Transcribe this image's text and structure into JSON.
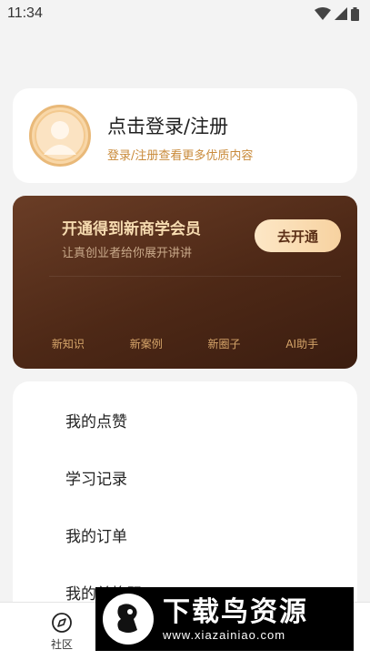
{
  "status_bar": {
    "time": "11:34",
    "icons": [
      "wifi-icon",
      "signal-icon",
      "battery-icon"
    ]
  },
  "login": {
    "title": "点击登录/注册",
    "subtitle": "登录/注册查看更多优质内容",
    "avatar_icon": "default-avatar-icon"
  },
  "vip": {
    "title": "开通得到新商学会员",
    "subtitle": "让真创业者给你展开讲讲",
    "button": "去开通",
    "features": [
      "新知识",
      "新案例",
      "新圈子",
      "AI助手"
    ]
  },
  "menu": {
    "items": [
      "我的点赞",
      "学习记录",
      "我的订单",
      "我的兑换码"
    ]
  },
  "bottom_nav": {
    "items": [
      {
        "label": "社区",
        "icon": "compass-icon"
      }
    ]
  },
  "watermark": {
    "title": "下载鸟资源",
    "url": "www.xiazainiao.com"
  },
  "colors": {
    "page_bg": "#f3f3f3",
    "accent_gold": "#c98a3a",
    "vip_bg": "#4d2816",
    "vip_text": "#f6dbb0"
  }
}
